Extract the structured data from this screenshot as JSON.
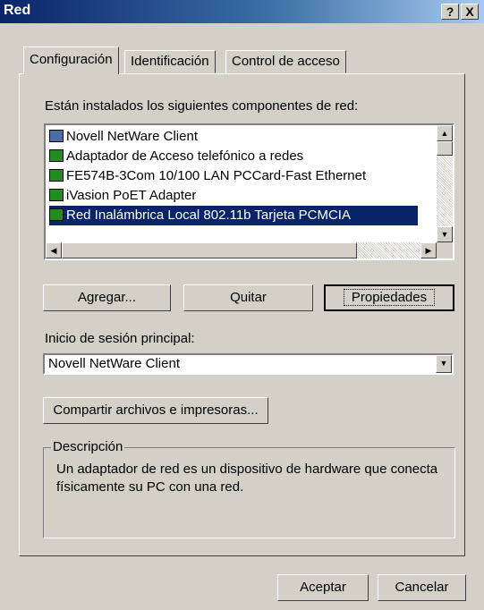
{
  "window": {
    "title": "Red",
    "help_button": "?",
    "close_button": "X"
  },
  "tabs": [
    {
      "label": "Configuración"
    },
    {
      "label": "Identificación"
    },
    {
      "label": "Control de acceso"
    }
  ],
  "components": {
    "label": "Están instalados los siguientes componentes de red:",
    "items": [
      {
        "label": "Novell NetWare Client",
        "icon": "network-client-icon"
      },
      {
        "label": "Adaptador de Acceso telefónico a redes",
        "icon": "network-adapter-icon"
      },
      {
        "label": "FE574B-3Com 10/100 LAN PCCard-Fast Ethernet",
        "icon": "network-adapter-icon"
      },
      {
        "label": "iVasion PoET Adapter",
        "icon": "network-adapter-icon"
      },
      {
        "label": "Red Inalámbrica Local 802.11b Tarjeta PCMCIA",
        "icon": "network-adapter-icon",
        "selected": true
      }
    ]
  },
  "buttons": {
    "add": "Agregar...",
    "remove": "Quitar",
    "properties": "Propiedades",
    "share": "Compartir archivos e impresoras...",
    "ok": "Aceptar",
    "cancel": "Cancelar"
  },
  "logon": {
    "label": "Inicio de sesión principal:",
    "value": "Novell NetWare Client"
  },
  "description": {
    "title": "Descripción",
    "text": "Un adaptador de red es un dispositivo de hardware que conecta físicamente su PC con una red."
  },
  "colors": {
    "selection": "#0a246a",
    "face": "#d4d0c8",
    "title_start": "#0a246a",
    "title_end": "#a6caf0"
  }
}
